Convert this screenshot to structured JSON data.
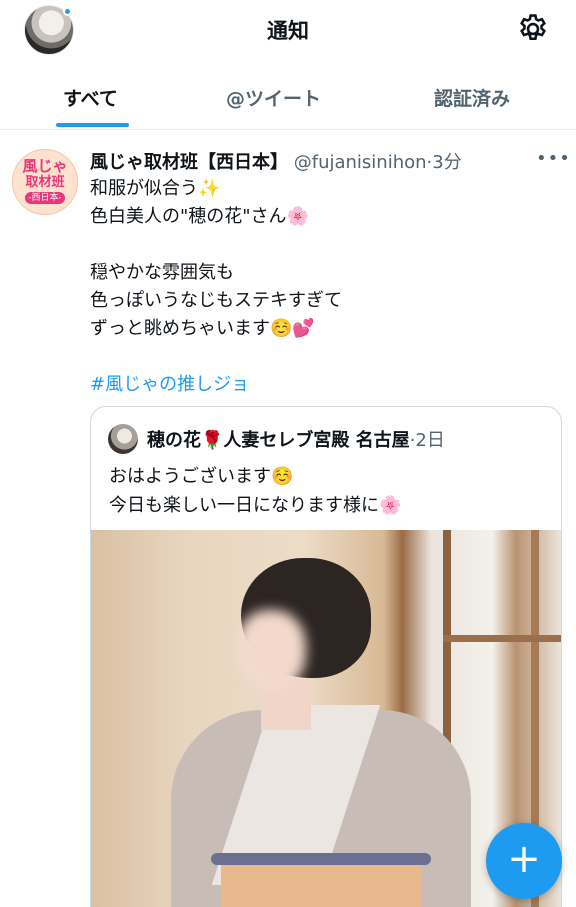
{
  "header": {
    "title": "通知",
    "settings_icon": "gear-icon",
    "has_notification_dot": true
  },
  "tabs": [
    {
      "label": "すべて",
      "active": true
    },
    {
      "label": "@ツイート",
      "active": false
    },
    {
      "label": "認証済み",
      "active": false
    }
  ],
  "tweet": {
    "avatar_lines": [
      "風じゃ",
      "取材班",
      "-西日本-"
    ],
    "name": "風じゃ取材班【西日本】",
    "handle": "@fujanisinihon",
    "time": "3分",
    "more_icon": "ellipsis-icon",
    "lines": [
      "和服が似合う✨",
      "色白美人の\"穂の花\"さん🌸",
      "",
      "穏やかな雰囲気も",
      "色っぽいうなじもステキすぎて",
      "ずっと眺めちゃいます☺️💕",
      ""
    ],
    "hashtag": "#風じゃの推しジョ"
  },
  "quoted": {
    "name": "穂の花🌹人妻セレブ宮殿 名古屋",
    "time": "2日",
    "lines": [
      "おはようございます☺️",
      "今日も楽しい一日になります様に🌸"
    ],
    "image": "woman-in-kimono-photo"
  },
  "fab": {
    "label": "+",
    "icon": "compose-plus-icon"
  },
  "colors": {
    "accent": "#1d9bf0",
    "text": "#0f1419",
    "secondary": "#536471",
    "border": "#cfd9de"
  }
}
